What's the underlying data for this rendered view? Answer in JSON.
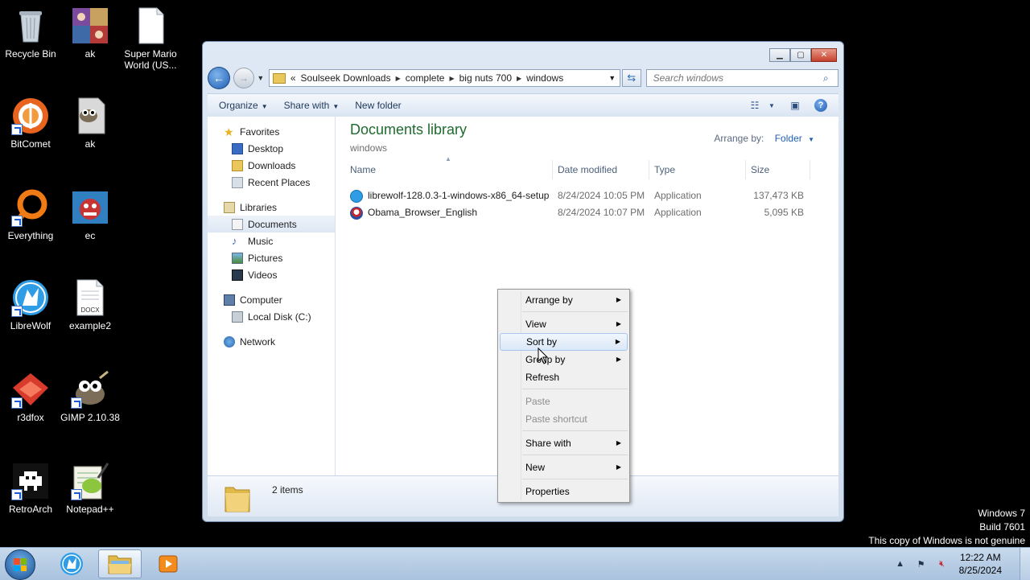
{
  "desktop": {
    "icons": [
      {
        "label": "Recycle Bin"
      },
      {
        "label": "ak"
      },
      {
        "label": "Super Mario World (US..."
      },
      {
        "label": "BitComet"
      },
      {
        "label": "ak"
      },
      {
        "label": "Everything"
      },
      {
        "label": "ec"
      },
      {
        "label": "LibreWolf"
      },
      {
        "label": "example2"
      },
      {
        "label": "r3dfox"
      },
      {
        "label": "GIMP 2.10.38"
      },
      {
        "label": "RetroArch"
      },
      {
        "label": "Notepad++"
      }
    ],
    "docx_badge": "DOCX"
  },
  "window": {
    "controls": {
      "minimize": "minimize-icon",
      "maximize": "maximize-icon",
      "close": "close-icon"
    },
    "address": {
      "overflow": "«",
      "crumbs": [
        "Soulseek Downloads",
        "complete",
        "big nuts 700",
        "windows"
      ]
    },
    "search": {
      "placeholder": "Search windows"
    },
    "toolbar": {
      "organize": "Organize",
      "share_with": "Share with",
      "new_folder": "New folder"
    },
    "nav": {
      "favorites": "Favorites",
      "desktop": "Desktop",
      "downloads": "Downloads",
      "recent_places": "Recent Places",
      "libraries": "Libraries",
      "documents": "Documents",
      "music": "Music",
      "pictures": "Pictures",
      "videos": "Videos",
      "computer": "Computer",
      "local_disk": "Local Disk (C:)",
      "network": "Network"
    },
    "library": {
      "title": "Documents library",
      "subtitle": "windows",
      "arrange_label": "Arrange by:",
      "arrange_value": "Folder"
    },
    "columns": {
      "name": "Name",
      "date": "Date modified",
      "type": "Type",
      "size": "Size"
    },
    "files": [
      {
        "name": "librewolf-128.0.3-1-windows-x86_64-setup",
        "date": "8/24/2024 10:05 PM",
        "type": "Application",
        "size": "137,473 KB"
      },
      {
        "name": "Obama_Browser_English",
        "date": "8/24/2024 10:07 PM",
        "type": "Application",
        "size": "5,095 KB"
      }
    ],
    "status": {
      "items": "2 items"
    }
  },
  "context_menu": {
    "arrange_by": "Arrange by",
    "view": "View",
    "sort_by": "Sort by",
    "group_by": "Group by",
    "refresh": "Refresh",
    "paste": "Paste",
    "paste_shortcut": "Paste shortcut",
    "share_with": "Share with",
    "new": "New",
    "properties": "Properties"
  },
  "watermark": {
    "line1": "Windows 7",
    "line2": "Build 7601",
    "line3": "This copy of Windows is not genuine"
  },
  "taskbar": {
    "time": "12:22 AM",
    "date": "8/25/2024"
  },
  "colors": {
    "library_title": "#1e6b2e",
    "accent": "#1e5fb4",
    "desktop": "#000000"
  }
}
